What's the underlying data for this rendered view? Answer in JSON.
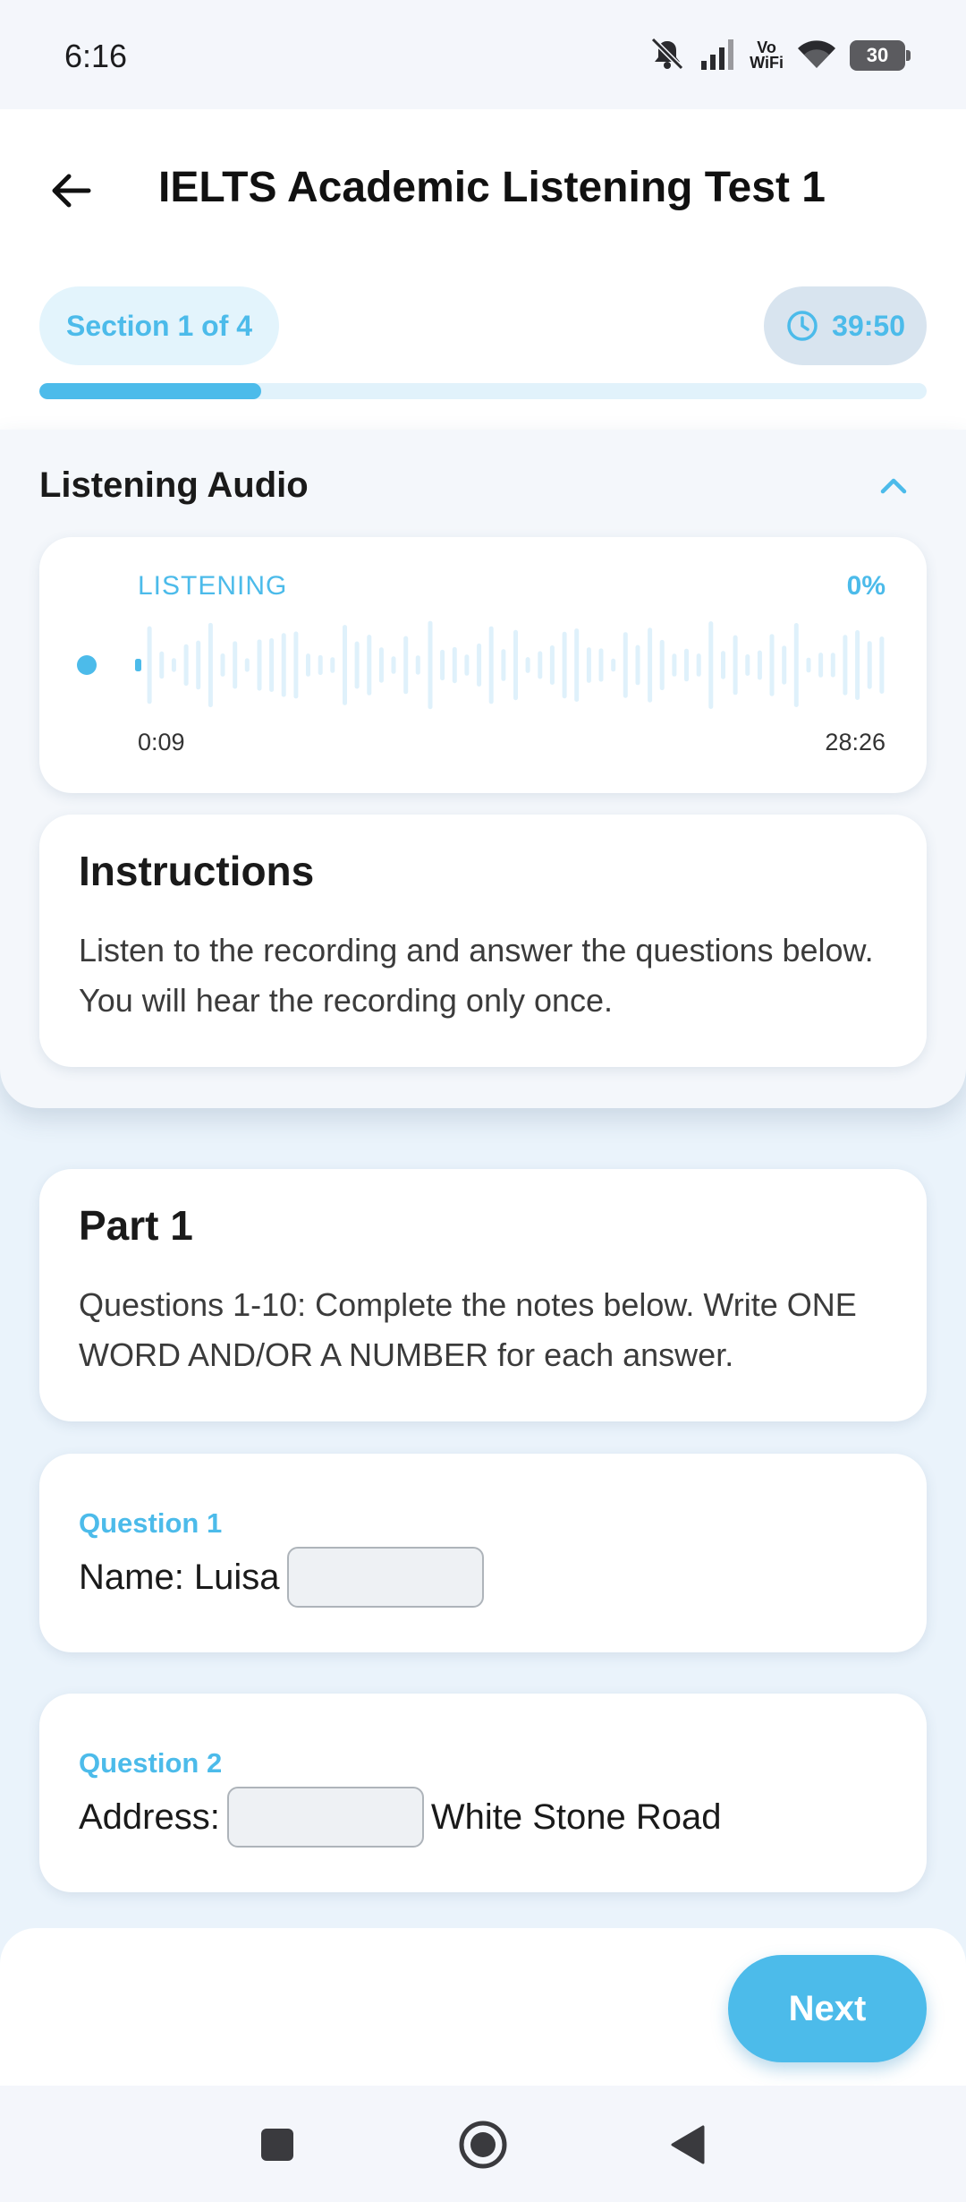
{
  "status_bar": {
    "time": "6:16",
    "vowifi_top": "Vo",
    "vowifi_bottom": "WiFi",
    "battery": "30",
    "icons": [
      "mute-icon",
      "signal-icon",
      "vowifi-icon",
      "wifi-icon",
      "battery-icon"
    ]
  },
  "header": {
    "title": "IELTS Academic Listening Test 1",
    "section": "Section 1 of 4",
    "timer": "39:50",
    "progress_fraction": 0.25,
    "accent_color": "#4cbbea"
  },
  "audio": {
    "panel_title": "Listening Audio",
    "state_label": "LISTENING",
    "percent": "0%",
    "current_time": "0:09",
    "total_time": "28:26"
  },
  "instructions": {
    "title": "Instructions",
    "text": "Listen to the recording and answer the questions below. You will hear the recording only once."
  },
  "part": {
    "title": "Part 1",
    "text": "Questions 1-10: Complete the notes below. Write ONE WORD AND/OR A NUMBER for each answer."
  },
  "questions": [
    {
      "label": "Question 1",
      "before": "Name: Luisa",
      "after": "",
      "value": ""
    },
    {
      "label": "Question 2",
      "before": "Address:",
      "after": "White Stone Road",
      "value": ""
    }
  ],
  "footer": {
    "next_label": "Next"
  }
}
